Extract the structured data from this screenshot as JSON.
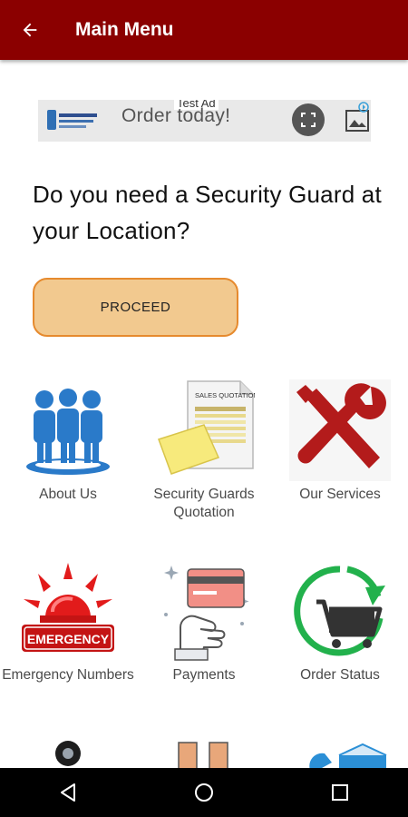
{
  "appbar": {
    "title": "Main Menu"
  },
  "ad": {
    "text": "Order today!",
    "tag": "Test Ad"
  },
  "question": "Do you need a Security Guard at your Location?",
  "proceed_label": "PROCEED",
  "menu": [
    {
      "label": "About Us",
      "icon": "people-icon"
    },
    {
      "label": "Security Guards Quotation",
      "icon": "quotation-document-icon"
    },
    {
      "label": "Our Services",
      "icon": "tools-icon"
    },
    {
      "label": "Emergency Numbers",
      "icon": "emergency-siren-icon"
    },
    {
      "label": "Payments",
      "icon": "card-payment-icon"
    },
    {
      "label": "Order Status",
      "icon": "cart-status-icon"
    }
  ],
  "quotation_doc_header": "SALES QUOTATION",
  "emergency_sign": "EMERGENCY",
  "colors": {
    "appbar": "#8b0000",
    "proceed_bg": "#f2c98f",
    "proceed_border": "#e68a2e"
  }
}
